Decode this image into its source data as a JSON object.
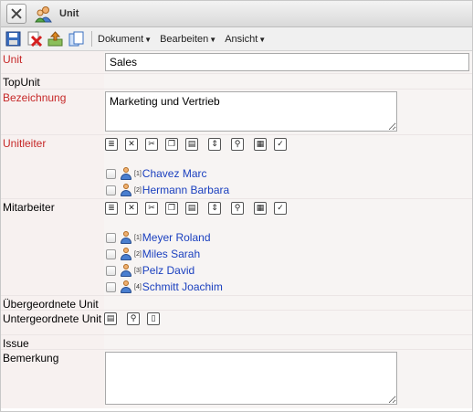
{
  "window": {
    "title": "Unit"
  },
  "toolbar": {
    "menus": [
      {
        "label": "Dokument"
      },
      {
        "label": "Bearbeiten"
      },
      {
        "label": "Ansicht"
      }
    ]
  },
  "form": {
    "unit": {
      "label": "Unit",
      "value": "Sales"
    },
    "topunit": {
      "label": "TopUnit"
    },
    "bezeichnung": {
      "label": "Bezeichnung",
      "value": "Marketing und Vertrieb"
    },
    "unitleiter": {
      "label": "Unitleiter",
      "people": [
        {
          "index": "[1]",
          "name": "Chavez Marc"
        },
        {
          "index": "[2]",
          "name": "Hermann Barbara"
        }
      ]
    },
    "mitarbeiter": {
      "label": "Mitarbeiter",
      "people": [
        {
          "index": "[1]",
          "name": "Meyer Roland"
        },
        {
          "index": "[2]",
          "name": "Miles Sarah"
        },
        {
          "index": "[3]",
          "name": "Pelz David"
        },
        {
          "index": "[4]",
          "name": "Schmitt Joachim"
        }
      ]
    },
    "uebergeordnete": {
      "label": "Übergeordnete Unit"
    },
    "untergeordnete": {
      "label": "Untergeordnete Unit"
    },
    "issue": {
      "label": "Issue"
    },
    "bemerkung": {
      "label": "Bemerkung",
      "value": ""
    }
  },
  "colors": {
    "required_label": "#c62828",
    "link": "#1a3fbf"
  }
}
